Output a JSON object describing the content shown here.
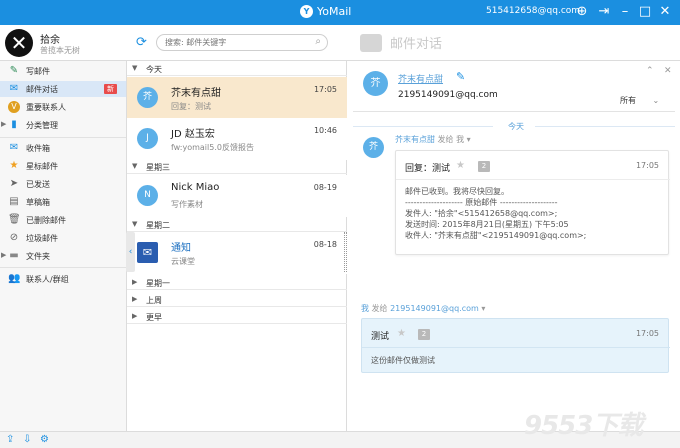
{
  "app": {
    "title": "YoMail",
    "account": "515412658@qq.com"
  },
  "user": {
    "name": "拾余",
    "signature": "普揽本无树"
  },
  "search": {
    "placeholder": "搜索: 邮件关键字"
  },
  "conversation_title": "邮件对话",
  "sidebar": {
    "items": [
      {
        "label": "写邮件"
      },
      {
        "label": "邮件对话",
        "badge": "新"
      },
      {
        "label": "重要联系人"
      },
      {
        "label": "分类管理"
      },
      {
        "label": "收件箱"
      },
      {
        "label": "星标邮件"
      },
      {
        "label": "已发送"
      },
      {
        "label": "草稿箱"
      },
      {
        "label": "已删除邮件"
      },
      {
        "label": "垃圾邮件"
      },
      {
        "label": "文件夹"
      },
      {
        "label": "联系人/群组"
      }
    ]
  },
  "list": {
    "groups": [
      "今天",
      "星期三",
      "星期二",
      "星期一",
      "上周",
      "更早"
    ],
    "mails": [
      {
        "avatar": "芥",
        "from": "芥末有点甜",
        "time": "17:05",
        "subject": "回复：测试"
      },
      {
        "avatar": "J",
        "from": "JD 赵玉宏",
        "time": "10:46",
        "subject": "fw:yomail5.0反馈报告"
      },
      {
        "avatar": "N",
        "from": "Nick Miao",
        "time": "08-19",
        "subject": "写作素材"
      },
      {
        "from": "通知",
        "time": "08-18",
        "subject": "云课堂"
      }
    ]
  },
  "detail": {
    "contact": {
      "avatar": "芥",
      "name": "芥末有点甜",
      "email": "2195149091@qq.com"
    },
    "filter": "所有",
    "day_label": "今天",
    "msg1": {
      "sender": "芥末有点甜",
      "action": "发给 我",
      "subject": "回复：测试",
      "count": "2",
      "time": "17:05",
      "lines": [
        "邮件已收到。我将尽快回复。",
        "-------------------- 原始邮件 --------------------",
        "发件人: \"拾余\"<515412658@qq.com>;",
        "发送时间: 2015年8月21日(星期五) 下午5:05",
        "收件人: \"芥末有点甜\"<2195149091@qq.com>;"
      ]
    },
    "msg2": {
      "sender": "我",
      "action": "发给",
      "to": "2195149091@qq.com",
      "subject": "测试",
      "count": "2",
      "time": "17:05",
      "body": "这份邮件仅做测试"
    }
  },
  "watermark": "9553下载"
}
